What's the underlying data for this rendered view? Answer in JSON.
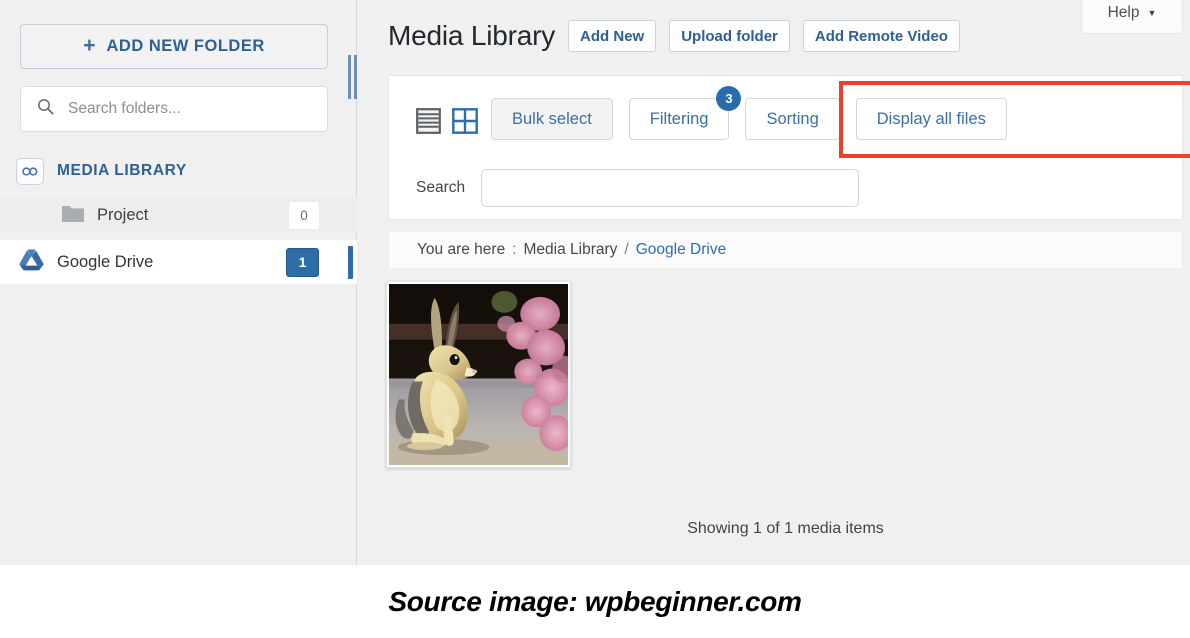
{
  "sidebar": {
    "add_folder": {
      "icon": "plus-icon",
      "label": "ADD NEW FOLDER"
    },
    "search": {
      "icon": "search-icon",
      "placeholder": "Search folders..."
    },
    "items": [
      {
        "icon": "media-library-icon",
        "label": "MEDIA LIBRARY",
        "count": ""
      },
      {
        "icon": "folder-icon",
        "label": "Project",
        "count": "0"
      },
      {
        "icon": "google-drive-icon",
        "label": "Google Drive",
        "count": "1"
      }
    ],
    "drag_handle": "resize-handle-icon"
  },
  "header": {
    "title": "Media Library",
    "buttons": [
      {
        "label": "Add New"
      },
      {
        "label": "Upload folder"
      },
      {
        "label": "Add Remote Video"
      }
    ],
    "help": {
      "label": "Help",
      "caret": "▼"
    }
  },
  "toolbar": {
    "view_modes": [
      {
        "icon": "list-view-icon",
        "active": false
      },
      {
        "icon": "grid-view-icon",
        "active": true
      }
    ],
    "buttons": [
      {
        "label": "Bulk select",
        "badge": "",
        "shaded": true
      },
      {
        "label": "Filtering",
        "badge": "3",
        "shaded": false
      },
      {
        "label": "Sorting",
        "badge": "",
        "shaded": false
      },
      {
        "label": "Display all files",
        "badge": "",
        "shaded": false
      }
    ],
    "highlight_color": "#e8432a"
  },
  "search": {
    "label": "Search",
    "value": "",
    "placeholder": ""
  },
  "breadcrumb": {
    "prefix": "You are here",
    "separator_colon": ":",
    "root": "Media Library",
    "divider": "/",
    "current": "Google Drive"
  },
  "content": {
    "items": [
      {
        "name": "rabbit-thumbnail",
        "alt": "rabbit"
      }
    ],
    "showing_text": "Showing 1 of 1 media items"
  },
  "caption": {
    "text": "Source image: wpbeginner.com"
  },
  "colors": {
    "accent_blue": "#2f6094",
    "highlight_red": "#e8432a",
    "badge_blue": "#2a6ca9",
    "page_bg": "#f0f0f0"
  }
}
